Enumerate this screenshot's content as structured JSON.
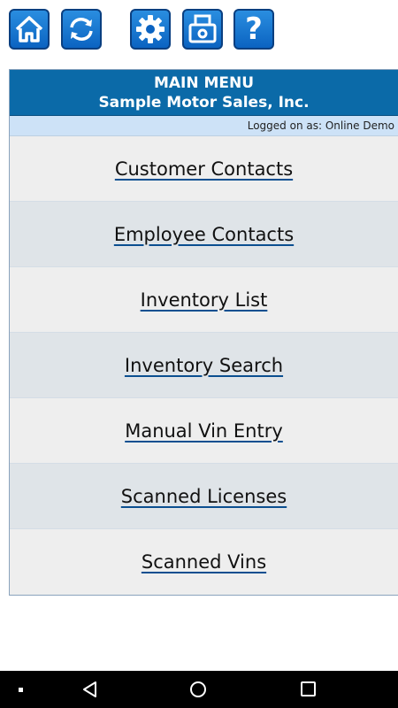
{
  "toolbar": {
    "buttons": [
      {
        "icon": "home-icon"
      },
      {
        "icon": "refresh-icon"
      },
      {
        "icon": "gear-icon"
      },
      {
        "icon": "printer-icon"
      },
      {
        "icon": "help-icon",
        "label": "?"
      }
    ]
  },
  "menu": {
    "title": "MAIN MENU",
    "company": "Sample Motor Sales, Inc.",
    "logged_on": "Logged on as: Online Demo",
    "items": [
      {
        "label": "Customer Contacts"
      },
      {
        "label": "Employee Contacts"
      },
      {
        "label": "Inventory List"
      },
      {
        "label": "Inventory Search"
      },
      {
        "label": "Manual Vin Entry"
      },
      {
        "label": "Scanned Licenses"
      },
      {
        "label": "Scanned Vins"
      }
    ]
  },
  "colors": {
    "header_bg": "#0b6aa8",
    "logged_bg": "#cde2f7",
    "button_blue": "#1a7fd6"
  },
  "navbar": {
    "icons": [
      "recent-dot-icon",
      "back-icon",
      "home-circle-icon",
      "overview-square-icon"
    ]
  }
}
